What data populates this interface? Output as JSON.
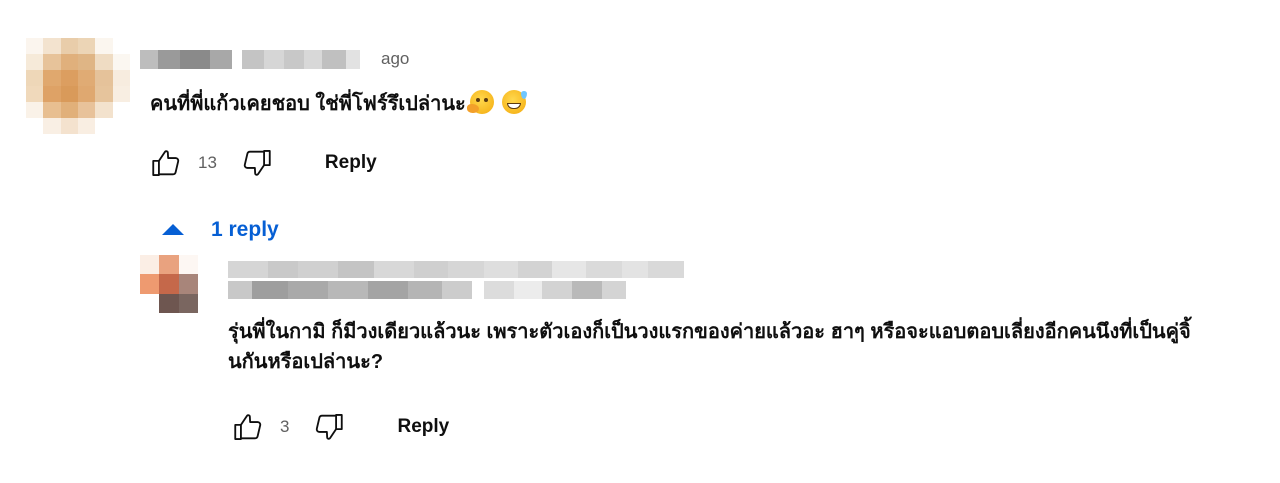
{
  "comment": {
    "date_suffix": "ago",
    "text": "คนที่พี่แก้วเคยชอบ ใช่พี่โฟร์รึเปล่านะ",
    "emojis": [
      "thinking-face",
      "grinning-face-with-sweat"
    ],
    "like_count": "13",
    "reply_label": "Reply"
  },
  "replies_toggle": {
    "label": "1 reply"
  },
  "reply": {
    "text": "รุ่นพี่ในกามิ ก็มีวงเดียวแล้วนะ เพราะตัวเองก็เป็นวงแรกของค่ายแล้วอะ ฮาๆ หรือจะแอบตอบเลี่ยงอีกคนนึงที่เป็นคู่จิ้นกันหรือเปล่านะ?",
    "like_count": "3",
    "reply_label": "Reply"
  },
  "colors": {
    "link_blue": "#065fd4",
    "secondary_text": "#606060",
    "primary_text": "#0f0f0f"
  },
  "icons": {
    "like": "thumbs-up-outline-icon",
    "dislike": "thumbs-down-outline-icon",
    "toggle": "caret-up-icon"
  }
}
